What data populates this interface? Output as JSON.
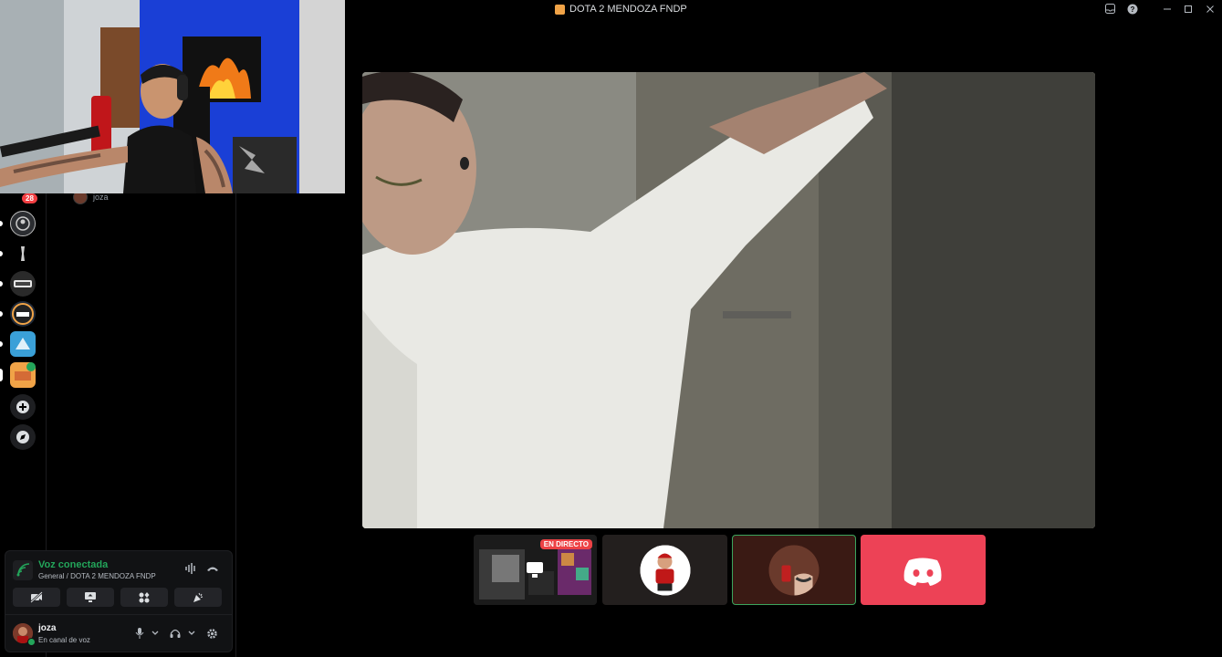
{
  "window": {
    "title": "DOTA 2 MENDOZA FNDP",
    "controls": [
      "inbox-icon",
      "help-icon",
      "minimize",
      "maximize",
      "close"
    ]
  },
  "server_rail": {
    "badge_count": "28"
  },
  "voice_channel": {
    "member_name": "joza"
  },
  "stream_tiles": {
    "live_badge": "EN DIRECTO"
  },
  "voice_panel": {
    "status": "Voz conectada",
    "location": "General / DOTA 2 MENDOZA FNDP",
    "buttons": [
      "camera-off-icon",
      "screen-share-icon",
      "activities-icon",
      "soundboard-icon"
    ]
  },
  "user_panel": {
    "name": "joza",
    "status": "En canal de voz"
  },
  "colors": {
    "connected": "#23a55a",
    "live": "#ed4245",
    "discord_tile": "#ed4256"
  }
}
